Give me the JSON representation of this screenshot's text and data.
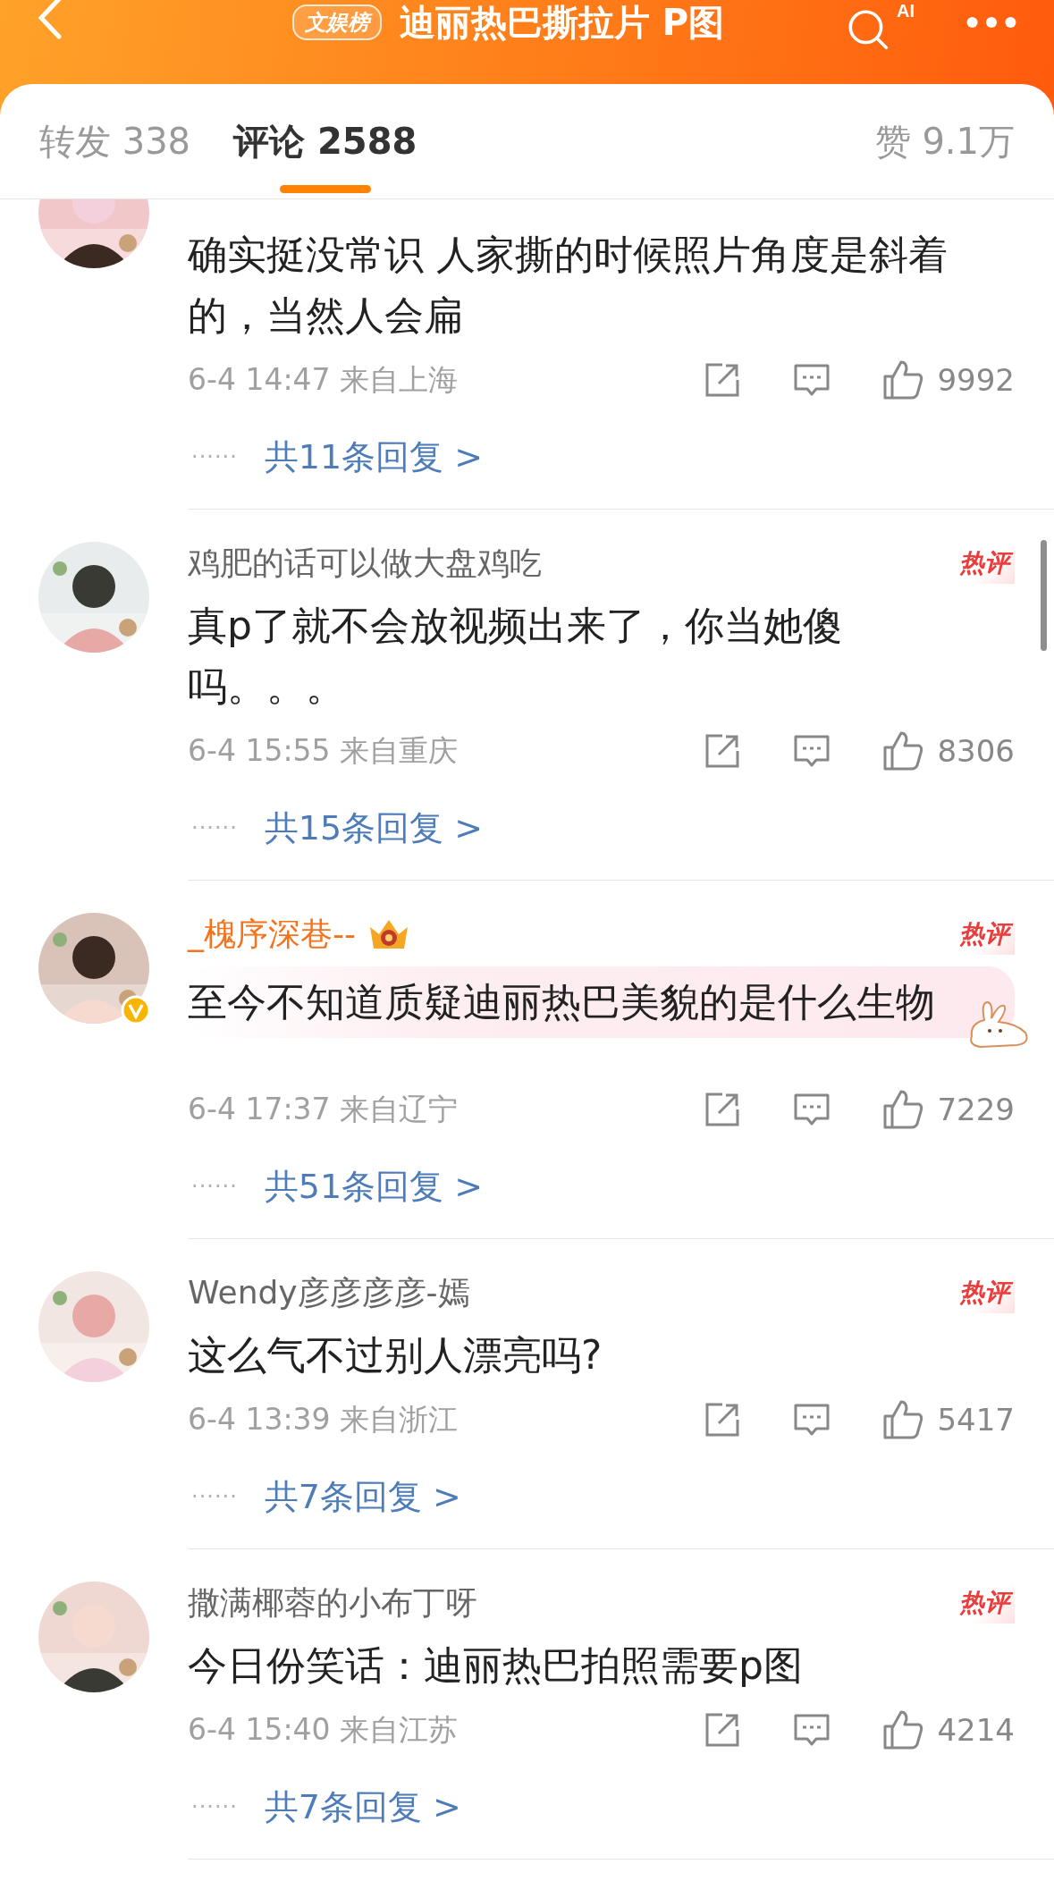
{
  "header": {
    "badge": "文娱榜",
    "title": "迪丽热巴撕拉片 P图",
    "search_ai_label": "AI"
  },
  "tabs": [
    {
      "label": "转发",
      "count": "338",
      "selected": false
    },
    {
      "label": "评论",
      "count": "2588",
      "selected": true
    }
  ],
  "likes": {
    "label": "赞",
    "count": "9.1万"
  },
  "comments": [
    {
      "cut": true,
      "text": "确实挺没常识 人家撕的时候照片角度是斜着的，当然人会扁",
      "time": "6-4 14:47",
      "location": "来自上海",
      "like_count": "9992",
      "dots": "······",
      "replies": "共11条回复 >"
    },
    {
      "cut": false,
      "name": "鸡肥的话可以做大盘鸡吃",
      "vip": false,
      "verified": false,
      "hot_label": "热评",
      "highlighted": false,
      "text": "真p了就不会放视频出来了，你当她傻吗。。。",
      "time": "6-4 15:55",
      "location": "来自重庆",
      "like_count": "8306",
      "dots": "······",
      "replies": "共15条回复 >"
    },
    {
      "cut": false,
      "name": "_槐序深巷--",
      "vip": true,
      "verified": true,
      "hot_label": "热评",
      "highlighted": true,
      "text": "至今不知道质疑迪丽热巴美貌的是什么生物",
      "time": "6-4 17:37",
      "location": "来自辽宁",
      "like_count": "7229",
      "dots": "······",
      "replies": "共51条回复 >"
    },
    {
      "cut": false,
      "name": "Wendy彦彦彦彦-嫣",
      "vip": false,
      "verified": false,
      "hot_label": "热评",
      "highlighted": false,
      "text": "这么气不过别人漂亮吗?",
      "time": "6-4 13:39",
      "location": "来自浙江",
      "like_count": "5417",
      "dots": "······",
      "replies": "共7条回复 >"
    },
    {
      "cut": false,
      "name": "撒满椰蓉的小布丁呀",
      "vip": false,
      "verified": false,
      "hot_label": "热评",
      "highlighted": false,
      "text": "今日份笑话：迪丽热巴拍照需要p图",
      "time": "6-4 15:40",
      "location": "来自江苏",
      "like_count": "4214",
      "dots": "······",
      "replies": "共7条回复 >"
    }
  ]
}
